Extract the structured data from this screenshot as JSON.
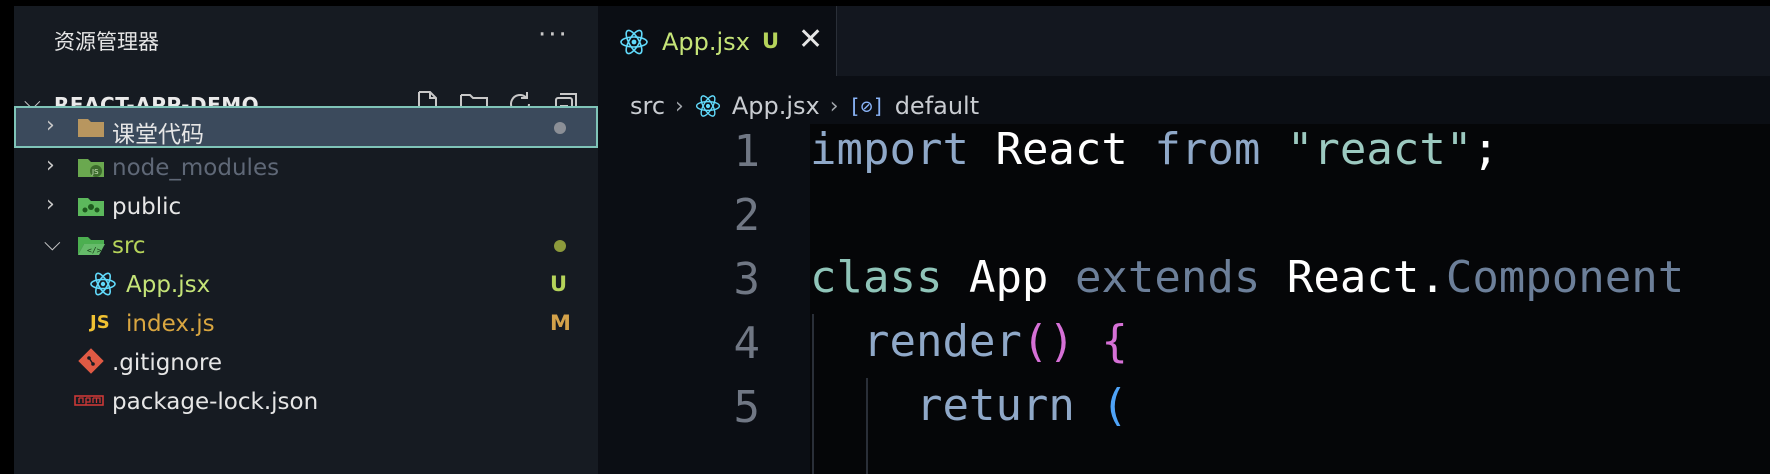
{
  "explorer": {
    "title": "资源管理器",
    "more": "···",
    "project": "REACT-APP-DEMO",
    "items": [
      {
        "label": "课堂代码",
        "type": "folder",
        "status": "dot"
      },
      {
        "label": "node_modules",
        "type": "folder"
      },
      {
        "label": "public",
        "type": "folder"
      },
      {
        "label": "src",
        "type": "folder",
        "status": "dot"
      },
      {
        "label": "App.jsx",
        "type": "file",
        "status": "U"
      },
      {
        "label": "index.js",
        "type": "file",
        "status": "M"
      },
      {
        "label": ".gitignore",
        "type": "file"
      },
      {
        "label": "package-lock.json",
        "type": "file"
      }
    ],
    "js_icon_text": "JS"
  },
  "editor": {
    "tab": {
      "label": "App.jsx",
      "status": "U",
      "close": "✕"
    },
    "breadcrumb": {
      "folder": "src",
      "file": "App.jsx",
      "symbol_icon": "[⊘]",
      "symbol": "default"
    },
    "line_numbers": [
      "1",
      "2",
      "3",
      "4",
      "5"
    ],
    "code": {
      "l1": {
        "kw": "import",
        "name": "React",
        "from": "from",
        "str": "\"react\"",
        "semi": ";"
      },
      "l3": {
        "kw": "class",
        "name": "App",
        "ext": "extends",
        "base": "React.",
        "comp": "Component"
      },
      "l4": {
        "fn": "render",
        "paren": "()",
        "brace": "{"
      },
      "l5": {
        "kw": "return",
        "paren": "("
      }
    }
  },
  "colors": {
    "accent_react": "#61dafb",
    "modified": "#d3a24a",
    "untracked": "#b5d35a",
    "selection_border": "#7fc4b8"
  }
}
